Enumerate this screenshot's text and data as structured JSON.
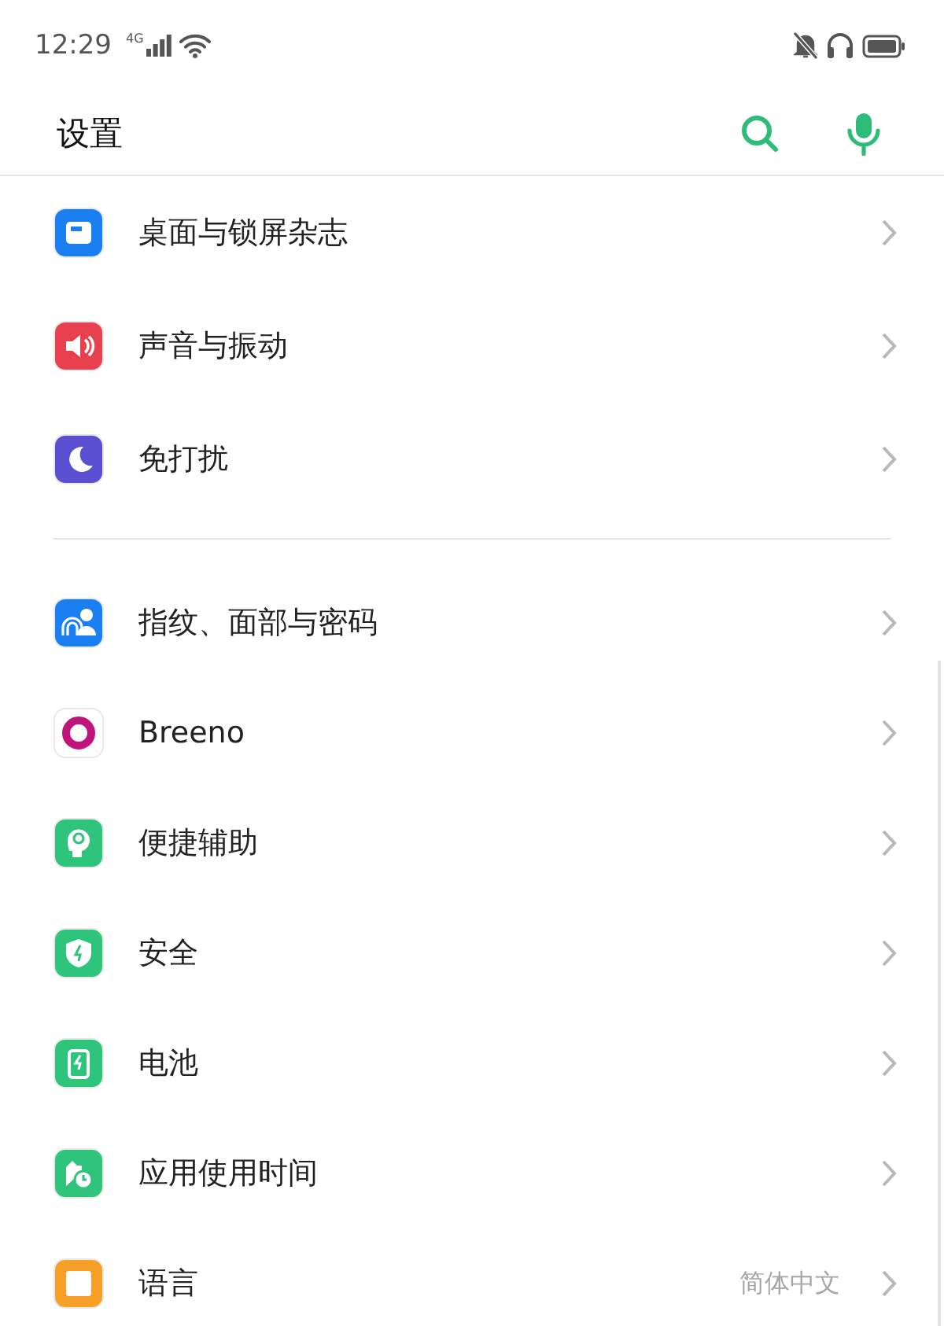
{
  "status_bar": {
    "time": "12:29",
    "network": "4G"
  },
  "header": {
    "title": "设置"
  },
  "groups": [
    {
      "items": [
        {
          "label": "桌面与锁屏杂志",
          "color": "#1a7ff0"
        },
        {
          "label": "声音与振动",
          "color": "#e8404f"
        },
        {
          "label": "免打扰",
          "color": "#5b4fd1"
        }
      ]
    },
    {
      "items": [
        {
          "label": "指纹、面部与密码",
          "color": "#1a7ff0"
        },
        {
          "label": "Breeno",
          "color": "#ffffff"
        },
        {
          "label": "便捷辅助",
          "color": "#2fc47c"
        },
        {
          "label": "安全",
          "color": "#2fc47c"
        },
        {
          "label": "电池",
          "color": "#2fc47c"
        },
        {
          "label": "应用使用时间",
          "color": "#2fc47c"
        },
        {
          "label": "语言",
          "color": "#f7a027",
          "value": "简体中文"
        }
      ]
    }
  ]
}
